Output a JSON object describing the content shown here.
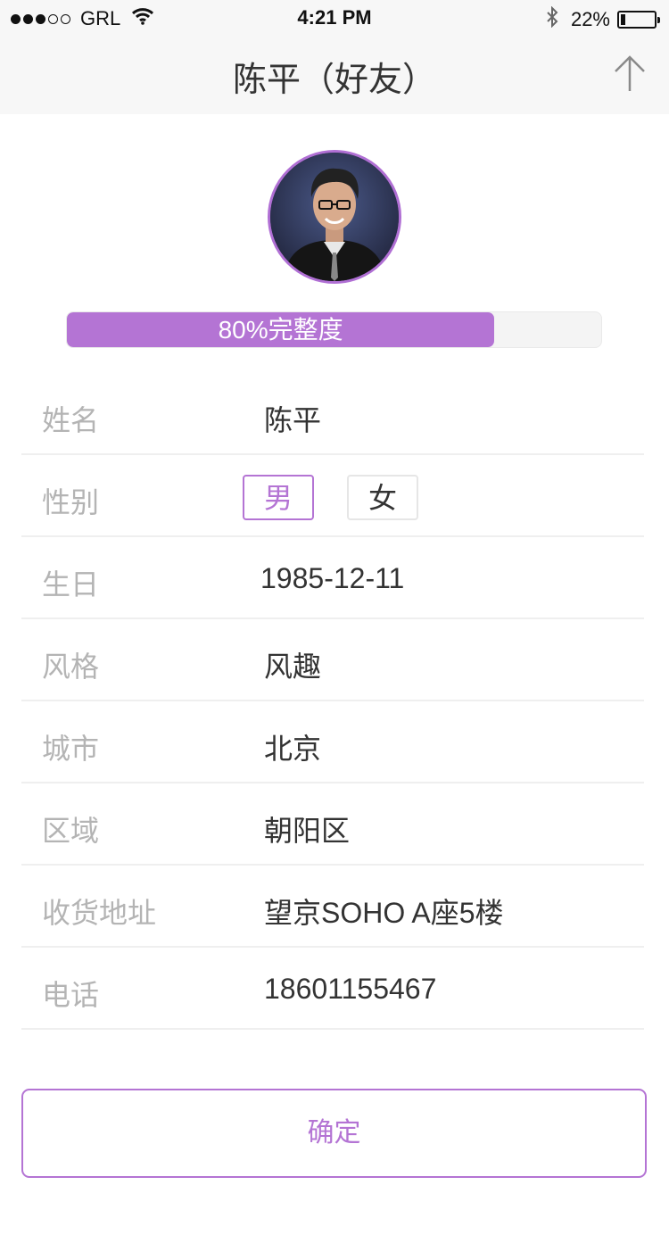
{
  "status_bar": {
    "carrier": "GRL",
    "time": "4:21 PM",
    "battery_percent": "22%",
    "battery_level": 0.22,
    "signal_bars": 3,
    "signal_total": 5
  },
  "nav": {
    "title": "陈平（好友）",
    "up_icon": "arrow-up-icon"
  },
  "profile": {
    "completeness_label": "80%完整度",
    "completeness_fraction": 0.8,
    "accent_color": "#b474d4"
  },
  "form": {
    "name": {
      "label": "姓名",
      "value": "陈平"
    },
    "gender": {
      "label": "性别",
      "options": [
        "男",
        "女"
      ],
      "selected": "男"
    },
    "birthday": {
      "label": "生日",
      "value": "1985-12-11"
    },
    "style": {
      "label": "风格",
      "value": "风趣"
    },
    "city": {
      "label": "城市",
      "value": "北京"
    },
    "district": {
      "label": "区域",
      "value": "朝阳区"
    },
    "address": {
      "label": "收货地址",
      "value": "望京SOHO A座5楼"
    },
    "phone": {
      "label": "电话",
      "value": "18601155467"
    }
  },
  "actions": {
    "confirm_label": "确定"
  }
}
